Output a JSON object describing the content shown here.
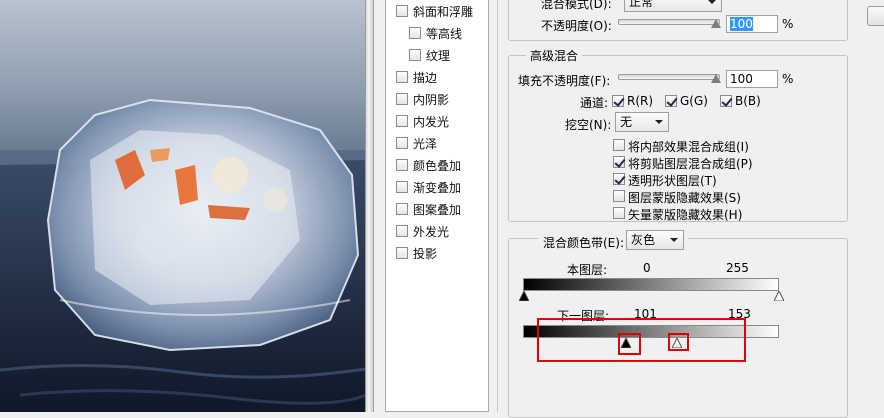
{
  "style_list": {
    "items": [
      {
        "label": "斜面和浮雕",
        "checked": false,
        "indent": false
      },
      {
        "label": "等高线",
        "checked": false,
        "indent": true
      },
      {
        "label": "纹理",
        "checked": false,
        "indent": true
      },
      {
        "label": "描边",
        "checked": false,
        "indent": false
      },
      {
        "label": "内阴影",
        "checked": false,
        "indent": false
      },
      {
        "label": "内发光",
        "checked": false,
        "indent": false
      },
      {
        "label": "光泽",
        "checked": false,
        "indent": false
      },
      {
        "label": "颜色叠加",
        "checked": false,
        "indent": false
      },
      {
        "label": "渐变叠加",
        "checked": false,
        "indent": false
      },
      {
        "label": "图案叠加",
        "checked": false,
        "indent": false
      },
      {
        "label": "外发光",
        "checked": false,
        "indent": false
      },
      {
        "label": "投影",
        "checked": false,
        "indent": false
      }
    ]
  },
  "general": {
    "blend_mode_label": "混合模式(D):",
    "blend_mode_value": "正常",
    "opacity_label": "不透明度(O):",
    "opacity_value": "100",
    "percent": "%"
  },
  "advanced": {
    "title": "高级混合",
    "fill_opacity_label": "填充不透明度(F):",
    "fill_opacity_value": "100",
    "percent": "%",
    "channels_label": "通道:",
    "channels": [
      {
        "label": "R(R)",
        "checked": true
      },
      {
        "label": "G(G)",
        "checked": true
      },
      {
        "label": "B(B)",
        "checked": true
      }
    ],
    "knockout_label": "挖空(N):",
    "knockout_value": "无",
    "options": [
      {
        "label": "将内部效果混合成组(I)",
        "checked": false
      },
      {
        "label": "将剪贴图层混合成组(P)",
        "checked": true
      },
      {
        "label": "透明形状图层(T)",
        "checked": true
      },
      {
        "label": "图层蒙版隐藏效果(S)",
        "checked": false
      },
      {
        "label": "矢量蒙版隐藏效果(H)",
        "checked": false
      }
    ]
  },
  "blend_if": {
    "label": "混合颜色带(E):",
    "value": "灰色",
    "this_layer_label": "本图层:",
    "this_layer_low": "0",
    "this_layer_high": "255",
    "underlying_label": "下一图层:",
    "underlying_low": "101",
    "underlying_high": "153"
  },
  "colors": {
    "highlight_box": "#e00000",
    "selection": "#3399ff"
  }
}
